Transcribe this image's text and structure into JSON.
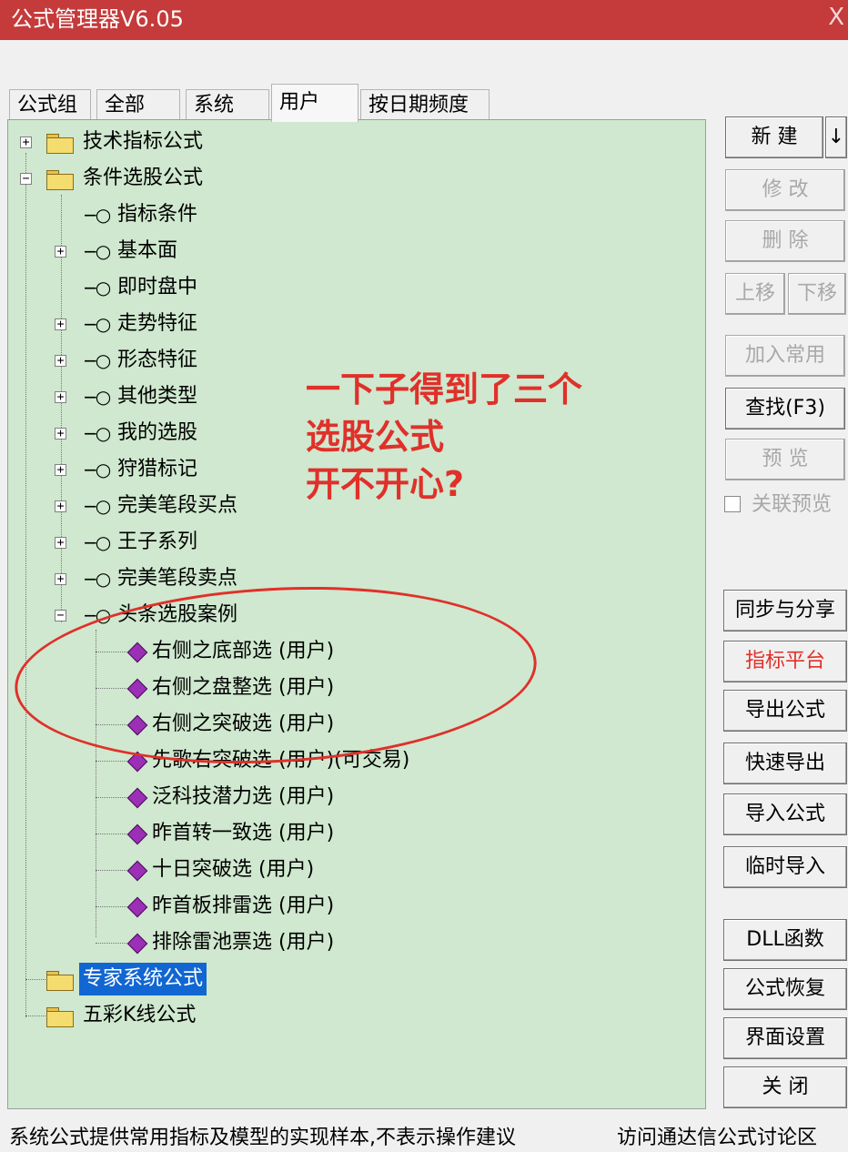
{
  "window": {
    "title": "公式管理器V6.05",
    "close_glyph": "X"
  },
  "tabs": [
    {
      "label": "公式组"
    },
    {
      "label": "全部"
    },
    {
      "label": "系统"
    },
    {
      "label": "用户",
      "active": true
    },
    {
      "label": "按日期频度"
    }
  ],
  "tree": {
    "items": [
      {
        "label": "技术指标公式"
      },
      {
        "label": "条件选股公式"
      },
      {
        "label": "指标条件"
      },
      {
        "label": "基本面"
      },
      {
        "label": "即时盘中"
      },
      {
        "label": "走势特征"
      },
      {
        "label": "形态特征"
      },
      {
        "label": "其他类型"
      },
      {
        "label": "我的选股"
      },
      {
        "label": "狩猎标记"
      },
      {
        "label": "完美笔段买点"
      },
      {
        "label": "王子系列"
      },
      {
        "label": "完美笔段卖点"
      },
      {
        "label": "头条选股案例"
      },
      {
        "label": "右侧之底部选  (用户)"
      },
      {
        "label": "右侧之盘整选  (用户)"
      },
      {
        "label": "右侧之突破选  (用户)"
      },
      {
        "label": "先歌右突破选  (用户)(可交易)"
      },
      {
        "label": "泛科技潜力选  (用户)"
      },
      {
        "label": "昨首转一致选  (用户)"
      },
      {
        "label": "十日突破选  (用户)"
      },
      {
        "label": "昨首板排雷选  (用户)"
      },
      {
        "label": "排除雷池票选  (用户)"
      },
      {
        "label": "专家系统公式",
        "selected": true
      },
      {
        "label": "五彩K线公式"
      }
    ]
  },
  "annotation": {
    "line1": "一下子得到了三个",
    "line2": "选股公式",
    "line3": "开不开心?",
    "color": "#e0302a"
  },
  "buttons": {
    "new": "新  建",
    "new_arrow": "↓",
    "modify": "修  改",
    "delete": "删  除",
    "move_up": "上移",
    "move_down": "下移",
    "add_common": "加入常用",
    "find": "查找(F3)",
    "preview": "预  览",
    "link_preview": "关联预览",
    "sync_share": "同步与分享",
    "indicator_platform": "指标平台",
    "export": "导出公式",
    "quick_export": "快速导出",
    "import": "导入公式",
    "temp_import": "临时导入",
    "dll": "DLL函数",
    "restore": "公式恢复",
    "ui_settings": "界面设置",
    "close": "关  闭"
  },
  "status": {
    "left": "系统公式提供常用指标及模型的实现样本,不表示操作建议",
    "right": "访问通达信公式讨论区"
  },
  "colors": {
    "titlebar": "#c53a3a",
    "tree_bg": "#cfe8cf",
    "selection": "#1166d2",
    "gem": "#9b2fb5"
  }
}
